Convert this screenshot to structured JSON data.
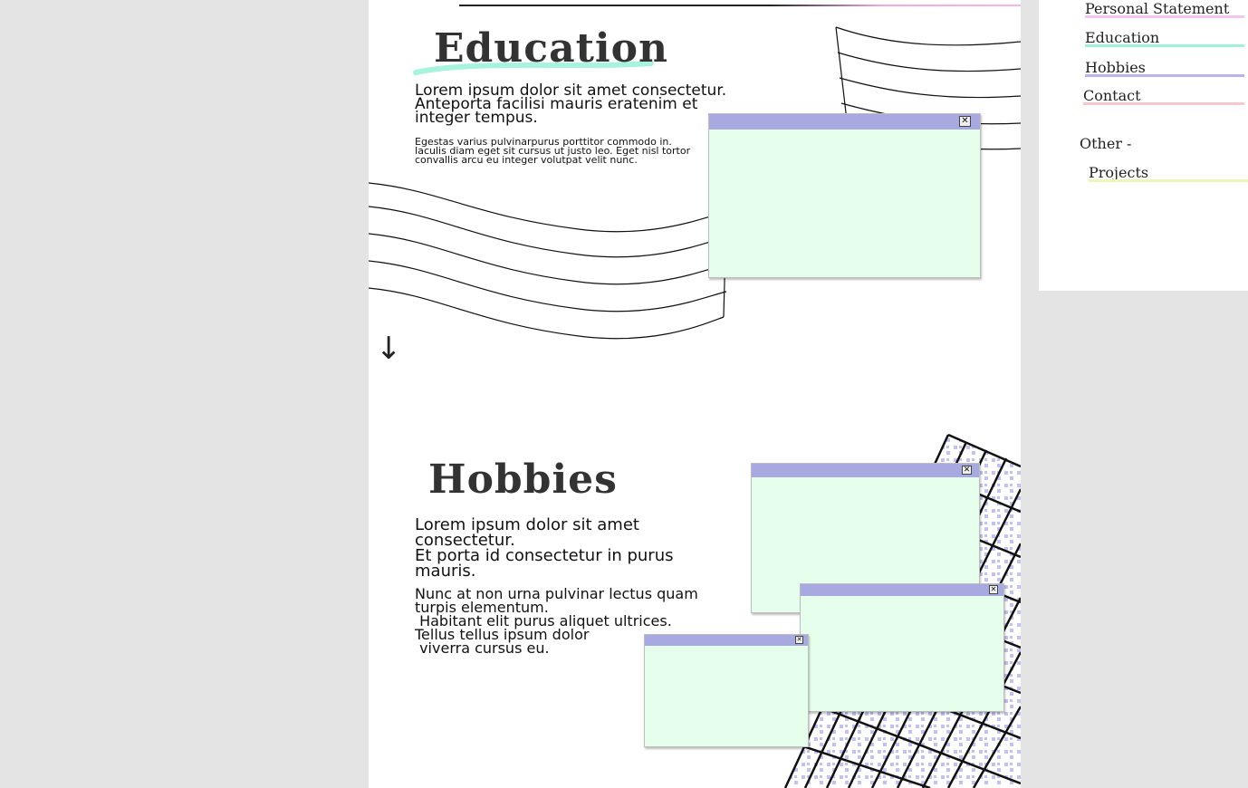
{
  "education": {
    "heading": "Education",
    "lead_lines": [
      "Lorem ipsum dolor sit amet consectetur.",
      "Anteporta facilisi mauris eratenim et",
      "integer tempus."
    ],
    "small_lines": [
      "Egestas varius pulvinarpurus porttitor commodo in.",
      "Iaculis diam eget sit cursus ut justo leo. Eget nisl tortor",
      "convallis arcu eu integer volutpat velit nunc."
    ]
  },
  "hobbies": {
    "heading": "Hobbies",
    "lead_lines": [
      "Lorem ipsum dolor sit amet",
      "consectetur.",
      "Et porta id consectetur in purus",
      "mauris."
    ],
    "body_lines": [
      "Nunc at non urna pulvinar lectus quam",
      "turpis elementum.",
      " Habitant elit purus aliquet ultrices.",
      "Tellus tellus ipsum dolor",
      " viverra cursus eu."
    ]
  },
  "window": {
    "close_glyph": "✕"
  },
  "scroll_arrow": "↓",
  "nav": {
    "items": [
      {
        "label": "Personal Statement",
        "underline_color": "#f3c6f0"
      },
      {
        "label": "Education",
        "underline_color": "#9ff2d8"
      },
      {
        "label": "Hobbies",
        "underline_color": "#b9b4ee"
      },
      {
        "label": "Contact",
        "underline_color": "#f4c8cf"
      },
      {
        "label": "Other -",
        "underline_color": ""
      },
      {
        "label": "Projects",
        "underline_color": "#eef7b8"
      }
    ]
  },
  "colors": {
    "window_bar": "#a9a9e1",
    "window_body": "#e6ffec",
    "highlight_mint": "#a6f3de",
    "pattern_lilac": "#c1c1f5"
  },
  "icons": [
    "close-icon",
    "arrow-down-icon"
  ]
}
